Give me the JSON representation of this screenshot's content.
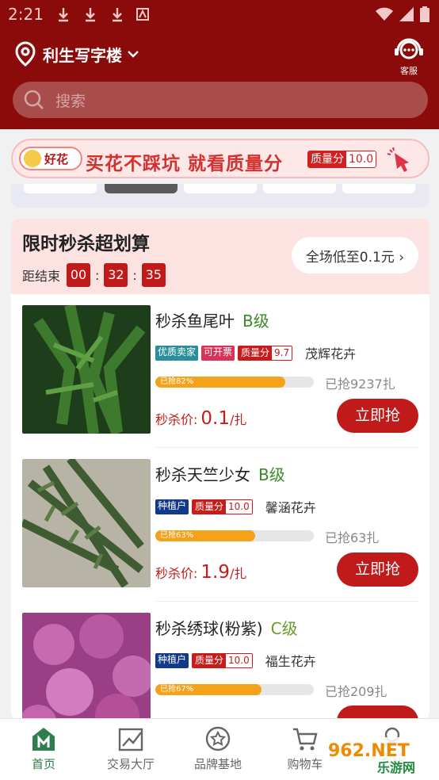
{
  "status_bar": {
    "time": "2:21"
  },
  "header": {
    "location": "利生写字楼",
    "customer_service": "客服",
    "search_placeholder": "搜索"
  },
  "banner": {
    "brand": "好花",
    "slogan": "买花不踩坑  就看质量分",
    "quality_label": "质量分",
    "quality_value": "10.0"
  },
  "flash_sale": {
    "title": "限时秒杀超划算",
    "countdown_label": "距结束",
    "countdown": {
      "h": "00",
      "m": "32",
      "s": "35"
    },
    "all_low": "全场低至0.1元 ›",
    "price_label": "秒杀价:",
    "unit": "/扎",
    "buy_label": "立即抢",
    "items": [
      {
        "name": "秒杀鱼尾叶",
        "grade": "B级",
        "tags": [
          "优质卖家",
          "可开票"
        ],
        "quality_label": "质量分",
        "quality": "9.7",
        "farm": "茂辉花卉",
        "progress": 82,
        "progress_text": "已抢82%",
        "sold": "已抢9237扎",
        "price": "0.1"
      },
      {
        "name": "秒杀天竺少女",
        "grade": "B级",
        "tags": [
          "种植户"
        ],
        "quality_label": "质量分",
        "quality": "10.0",
        "farm": "馨涵花卉",
        "progress": 63,
        "progress_text": "已抢63%",
        "sold": "已抢63扎",
        "price": "1.9"
      },
      {
        "name": "秒杀绣球(粉紫)",
        "grade": "C级",
        "tags": [
          "种植户"
        ],
        "quality_label": "质量分",
        "quality": "10.0",
        "farm": "福生花卉",
        "progress": 67,
        "progress_text": "已抢67%",
        "sold": "已抢209扎",
        "price": ""
      }
    ]
  },
  "tabbar": [
    {
      "label": "首页",
      "active": true
    },
    {
      "label": "交易大厅"
    },
    {
      "label": "品牌基地"
    },
    {
      "label": "购物车"
    },
    {
      "label": "我的"
    }
  ],
  "watermark": {
    "text1": "962.NET",
    "text2": "乐游网"
  },
  "colors": {
    "brand_red": "#8b0b0b",
    "accent_red": "#c01a1a",
    "green": "#2e7d4c",
    "progress": "#f4a21a"
  }
}
